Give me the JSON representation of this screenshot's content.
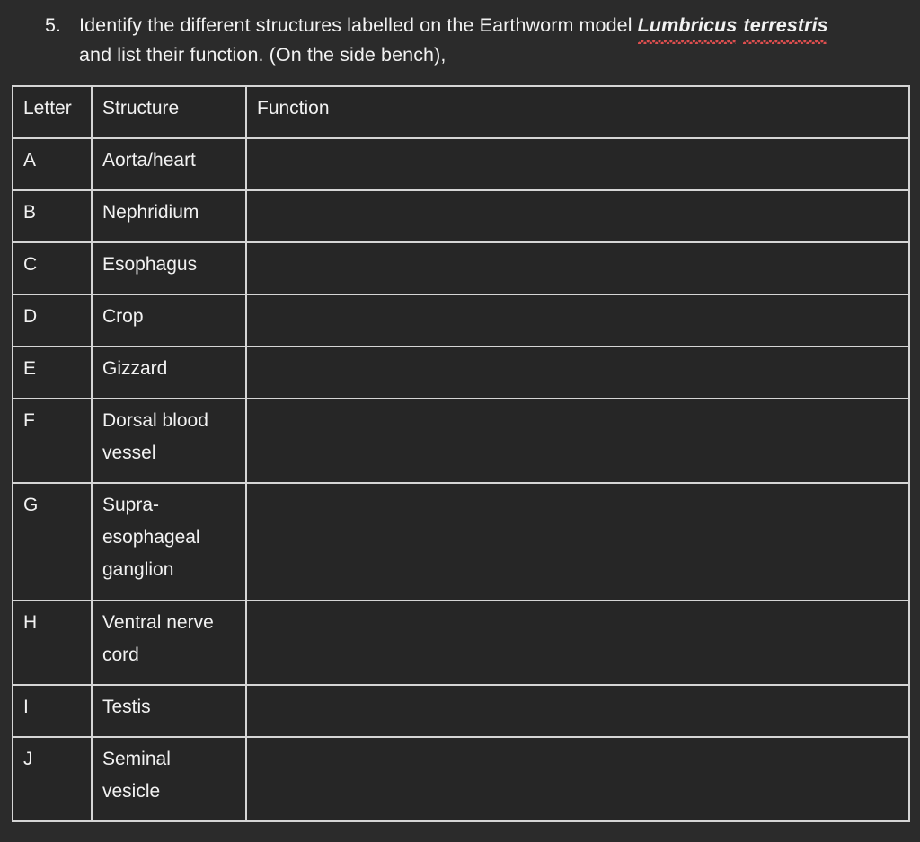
{
  "question": {
    "number": "5.",
    "line1_before_italic": "Identify the different structures labelled on the Earthworm model ",
    "italic_word1": "Lumbricus",
    "italic_word2": "terrestris",
    "line2": "and list their function. (On the side bench),"
  },
  "table": {
    "headers": {
      "letter": "Letter",
      "structure": "Structure",
      "function": "Function"
    },
    "rows": [
      {
        "letter": "A",
        "structure": "Aorta/heart",
        "function": ""
      },
      {
        "letter": "B",
        "structure": "Nephridium",
        "function": ""
      },
      {
        "letter": "C",
        "structure": "Esophagus",
        "function": ""
      },
      {
        "letter": "D",
        "structure": "Crop",
        "function": ""
      },
      {
        "letter": "E",
        "structure": "Gizzard",
        "function": ""
      },
      {
        "letter": "F",
        "structure": "Dorsal blood\nvessel",
        "function": ""
      },
      {
        "letter": "G",
        "structure": "Supra-\nesophageal\nganglion",
        "function": ""
      },
      {
        "letter": "H",
        "structure": "Ventral nerve\ncord",
        "function": ""
      },
      {
        "letter": "I",
        "structure": "Testis",
        "function": ""
      },
      {
        "letter": "J",
        "structure": "Seminal\nvesicle",
        "function": ""
      }
    ]
  },
  "colors": {
    "page_background": "#2b2b2b",
    "cell_background": "#262626",
    "border": "#d5d5d5",
    "text": "#f2f2f2",
    "spellcheck_underline": "#e04f4f"
  }
}
